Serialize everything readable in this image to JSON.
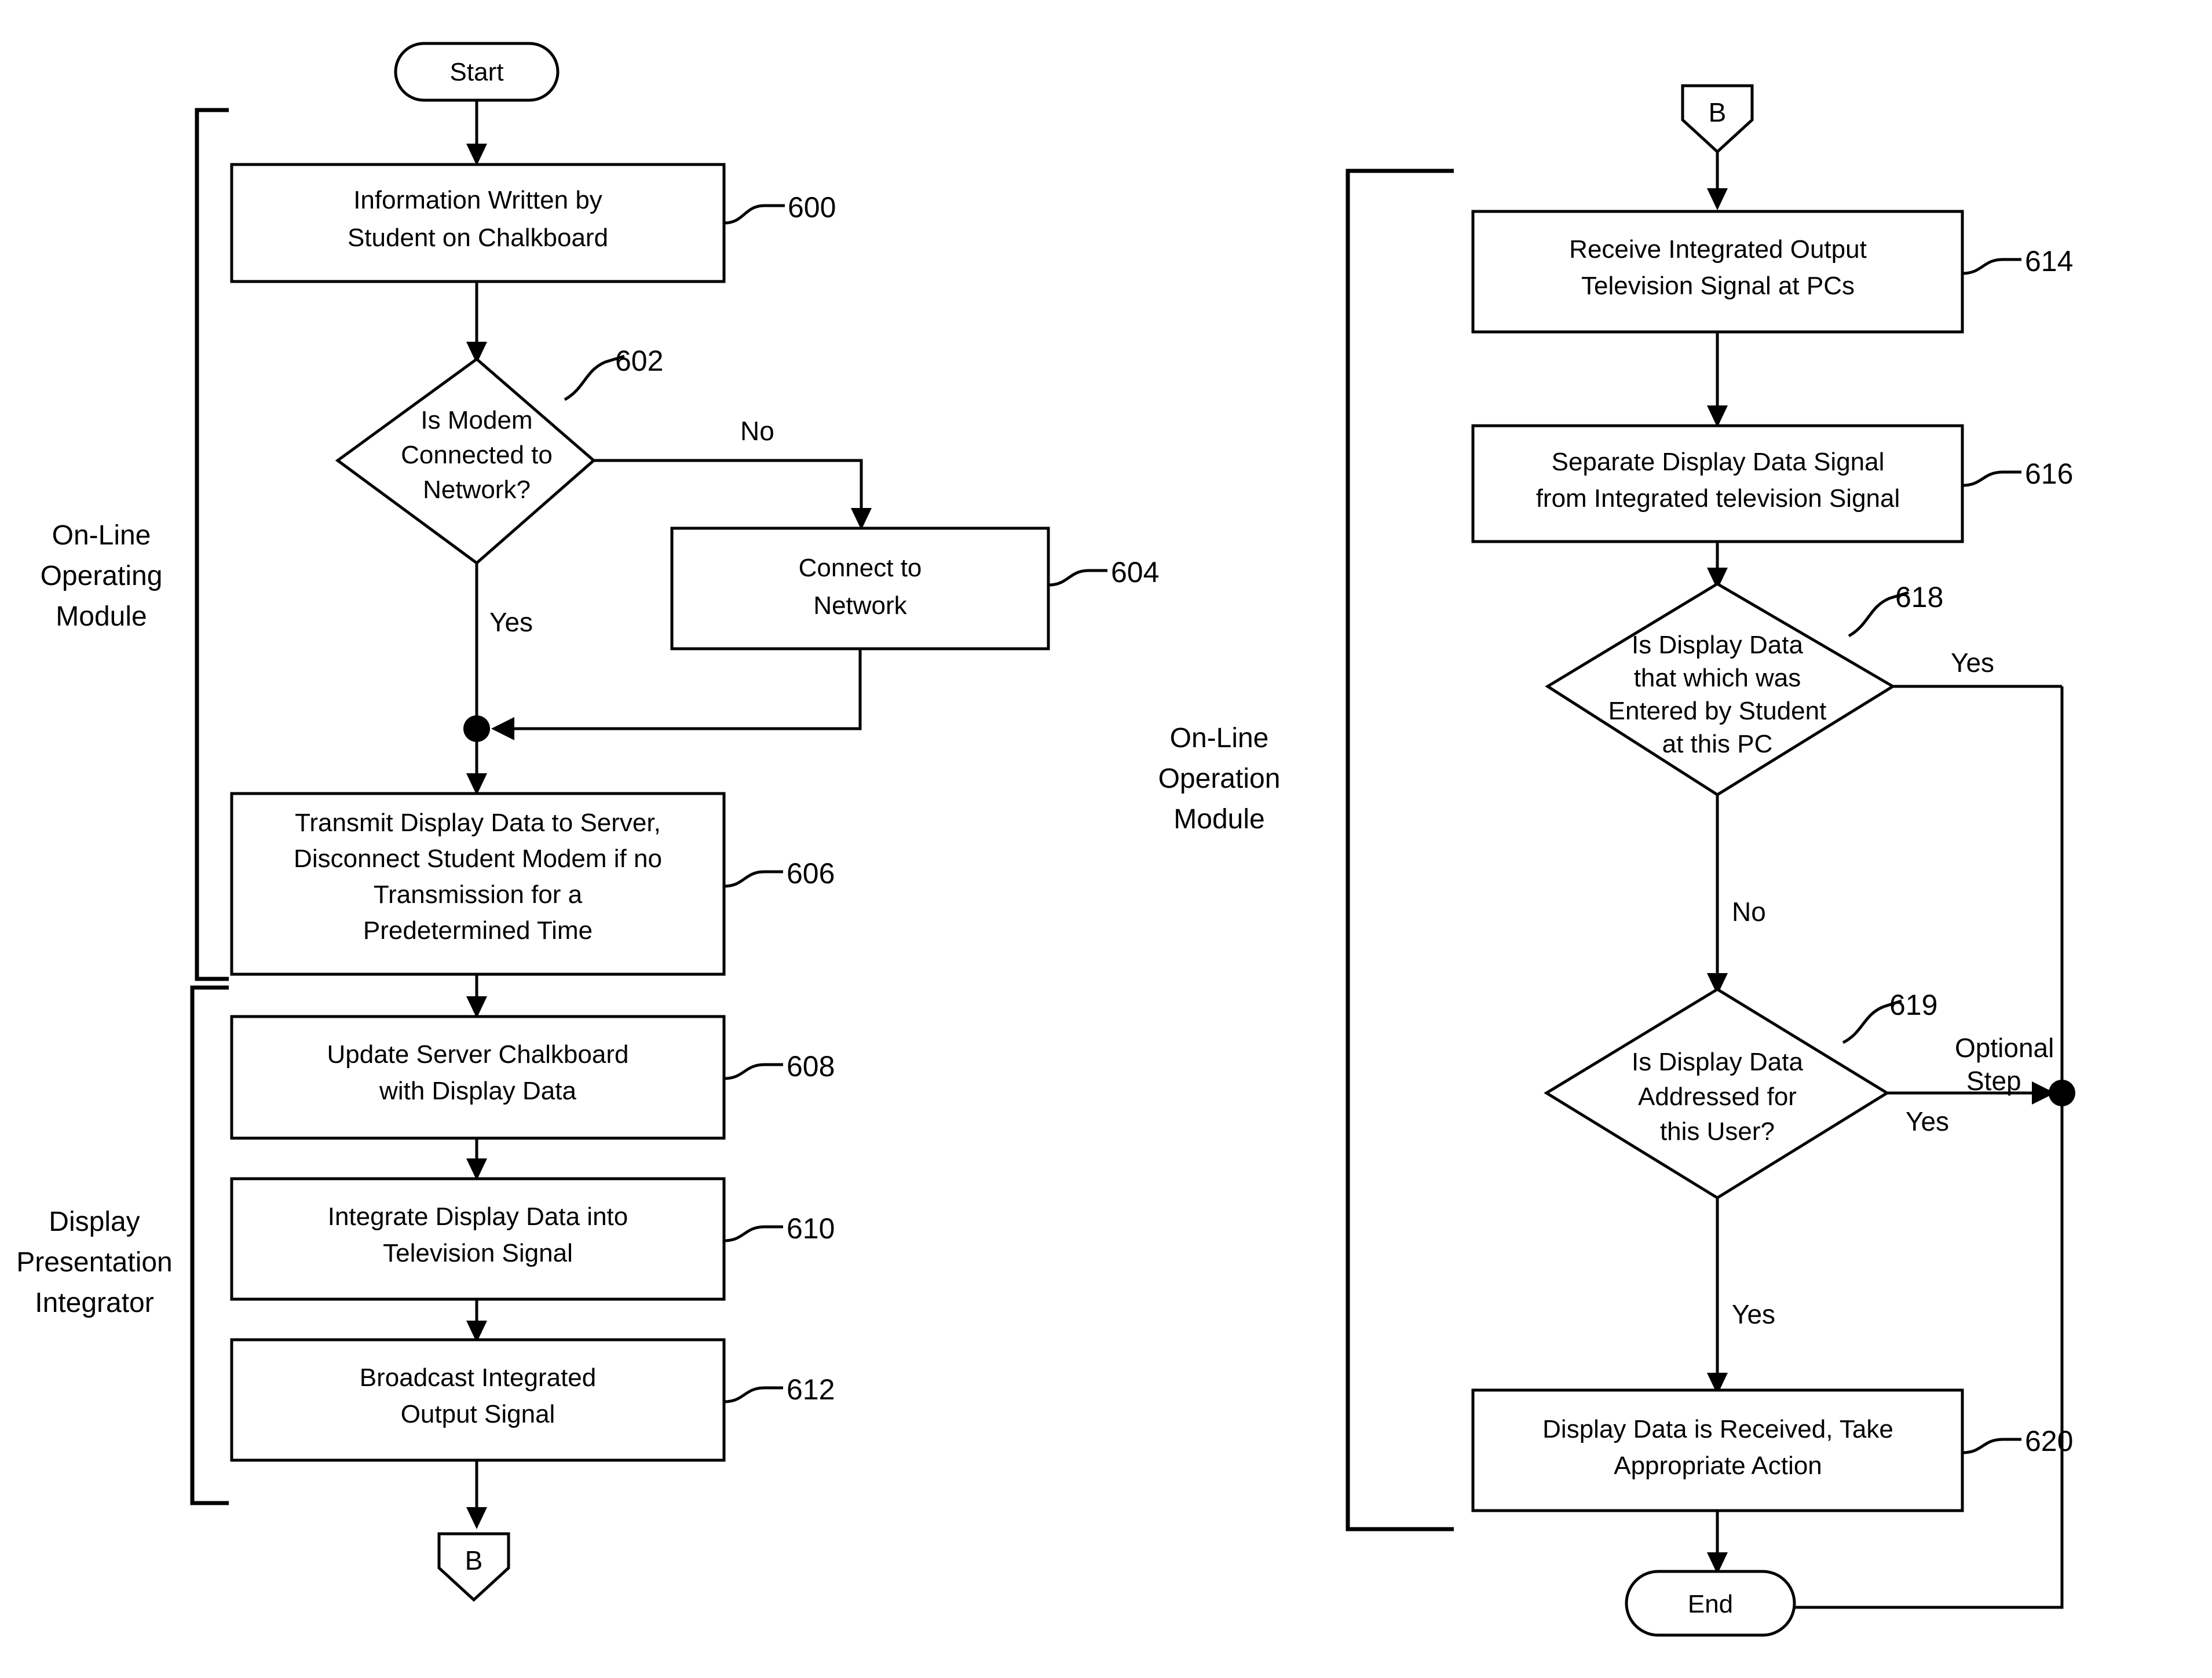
{
  "diagram": {
    "type": "flowchart",
    "groups": [
      {
        "id": "g-left-top",
        "label_lines": [
          "On-Line",
          "Operating",
          "Module"
        ]
      },
      {
        "id": "g-left-bot",
        "label_lines": [
          "Display",
          "Presentation",
          "Integrator"
        ]
      },
      {
        "id": "g-right",
        "label_lines": [
          "On-Line",
          "Operation",
          "Module"
        ]
      }
    ],
    "left_column": {
      "start": {
        "label": "Start"
      },
      "n600": {
        "ref": "600",
        "lines": [
          "Information Written by",
          "Student on Chalkboard"
        ]
      },
      "n602": {
        "ref": "602",
        "lines": [
          "Is Modem",
          "Connected to",
          "Network?"
        ]
      },
      "n604": {
        "ref": "604",
        "lines": [
          "Connect to",
          "Network"
        ]
      },
      "n606": {
        "ref": "606",
        "lines": [
          "Transmit Display Data to Server,",
          "Disconnect Student Modem if no",
          "Transmission for a",
          "Predetermined Time"
        ]
      },
      "n608": {
        "ref": "608",
        "lines": [
          "Update Server Chalkboard",
          "with Display Data"
        ]
      },
      "n610": {
        "ref": "610",
        "lines": [
          "Integrate Display Data into",
          "Television Signal"
        ]
      },
      "n612": {
        "ref": "612",
        "lines": [
          "Broadcast Integrated",
          "Output Signal"
        ]
      },
      "connector_b_out": {
        "label": "B"
      },
      "edge_no": "No",
      "edge_yes": "Yes"
    },
    "right_column": {
      "connector_b_in": {
        "label": "B"
      },
      "n614": {
        "ref": "614",
        "lines": [
          "Receive Integrated Output",
          "Television Signal at PCs"
        ]
      },
      "n616": {
        "ref": "616",
        "lines": [
          "Separate Display Data Signal",
          "from Integrated television Signal"
        ]
      },
      "n618": {
        "ref": "618",
        "lines": [
          "Is Display Data",
          "that which was",
          "Entered by Student",
          "at this PC"
        ]
      },
      "n619": {
        "ref": "619",
        "lines": [
          "Is Display Data",
          "Addressed for",
          "this User?"
        ]
      },
      "n620": {
        "ref": "620",
        "lines": [
          "Display Data is Received, Take",
          "Appropriate Action"
        ]
      },
      "end": {
        "label": "End"
      },
      "edge_618_yes": "Yes",
      "edge_618_no": "No",
      "edge_619_yes_right": "Yes",
      "edge_619_optional_lines": [
        "Optional",
        "Step"
      ],
      "edge_619_yes_down": "Yes"
    },
    "colors": {
      "stroke": "#000000",
      "fill": "#ffffff",
      "background": "#ffffff"
    }
  }
}
